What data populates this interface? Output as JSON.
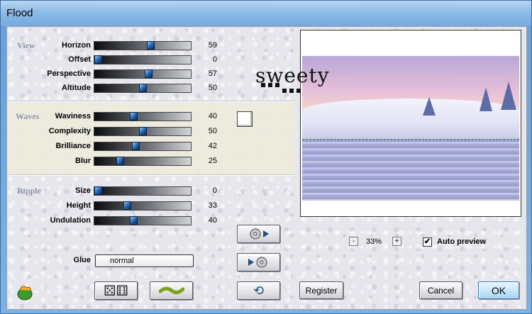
{
  "window": {
    "title": "Flood"
  },
  "groups": {
    "view": {
      "label": "View",
      "rows": [
        {
          "label": "Horizon",
          "value": "59",
          "level": 59
        },
        {
          "label": "Offset",
          "value": "0",
          "level": 0
        },
        {
          "label": "Perspective",
          "value": "57",
          "level": 57
        },
        {
          "label": "Altitude",
          "value": "50",
          "level": 50
        }
      ]
    },
    "waves": {
      "label": "Waves",
      "rows": [
        {
          "label": "Waviness",
          "value": "40",
          "level": 40
        },
        {
          "label": "Complexity",
          "value": "50",
          "level": 50
        },
        {
          "label": "Brilliance",
          "value": "42",
          "level": 42
        },
        {
          "label": "Blur",
          "value": "25",
          "level": 25
        }
      ]
    },
    "ripple": {
      "label": "Ripple",
      "rows": [
        {
          "label": "Size",
          "value": "0",
          "level": 0
        },
        {
          "label": "Height",
          "value": "33",
          "level": 33
        },
        {
          "label": "Undulation",
          "value": "40",
          "level": 40
        }
      ]
    }
  },
  "glue": {
    "label": "Glue",
    "value": "normal"
  },
  "preview": {
    "watermark": "sweety"
  },
  "zoom": {
    "value": "33%",
    "minus": "-",
    "plus": "+"
  },
  "auto_preview": {
    "label": "Auto preview",
    "checked": true,
    "mark": "✔"
  },
  "buttons": {
    "register": "Register",
    "cancel": "Cancel",
    "ok": "OK"
  },
  "icons": {
    "dice": "⚄⚅",
    "undo": "⟲"
  },
  "colors": {
    "accent": "#1c5fae",
    "waves_band": "#ecebdd",
    "group_label": "#8b93a6"
  }
}
